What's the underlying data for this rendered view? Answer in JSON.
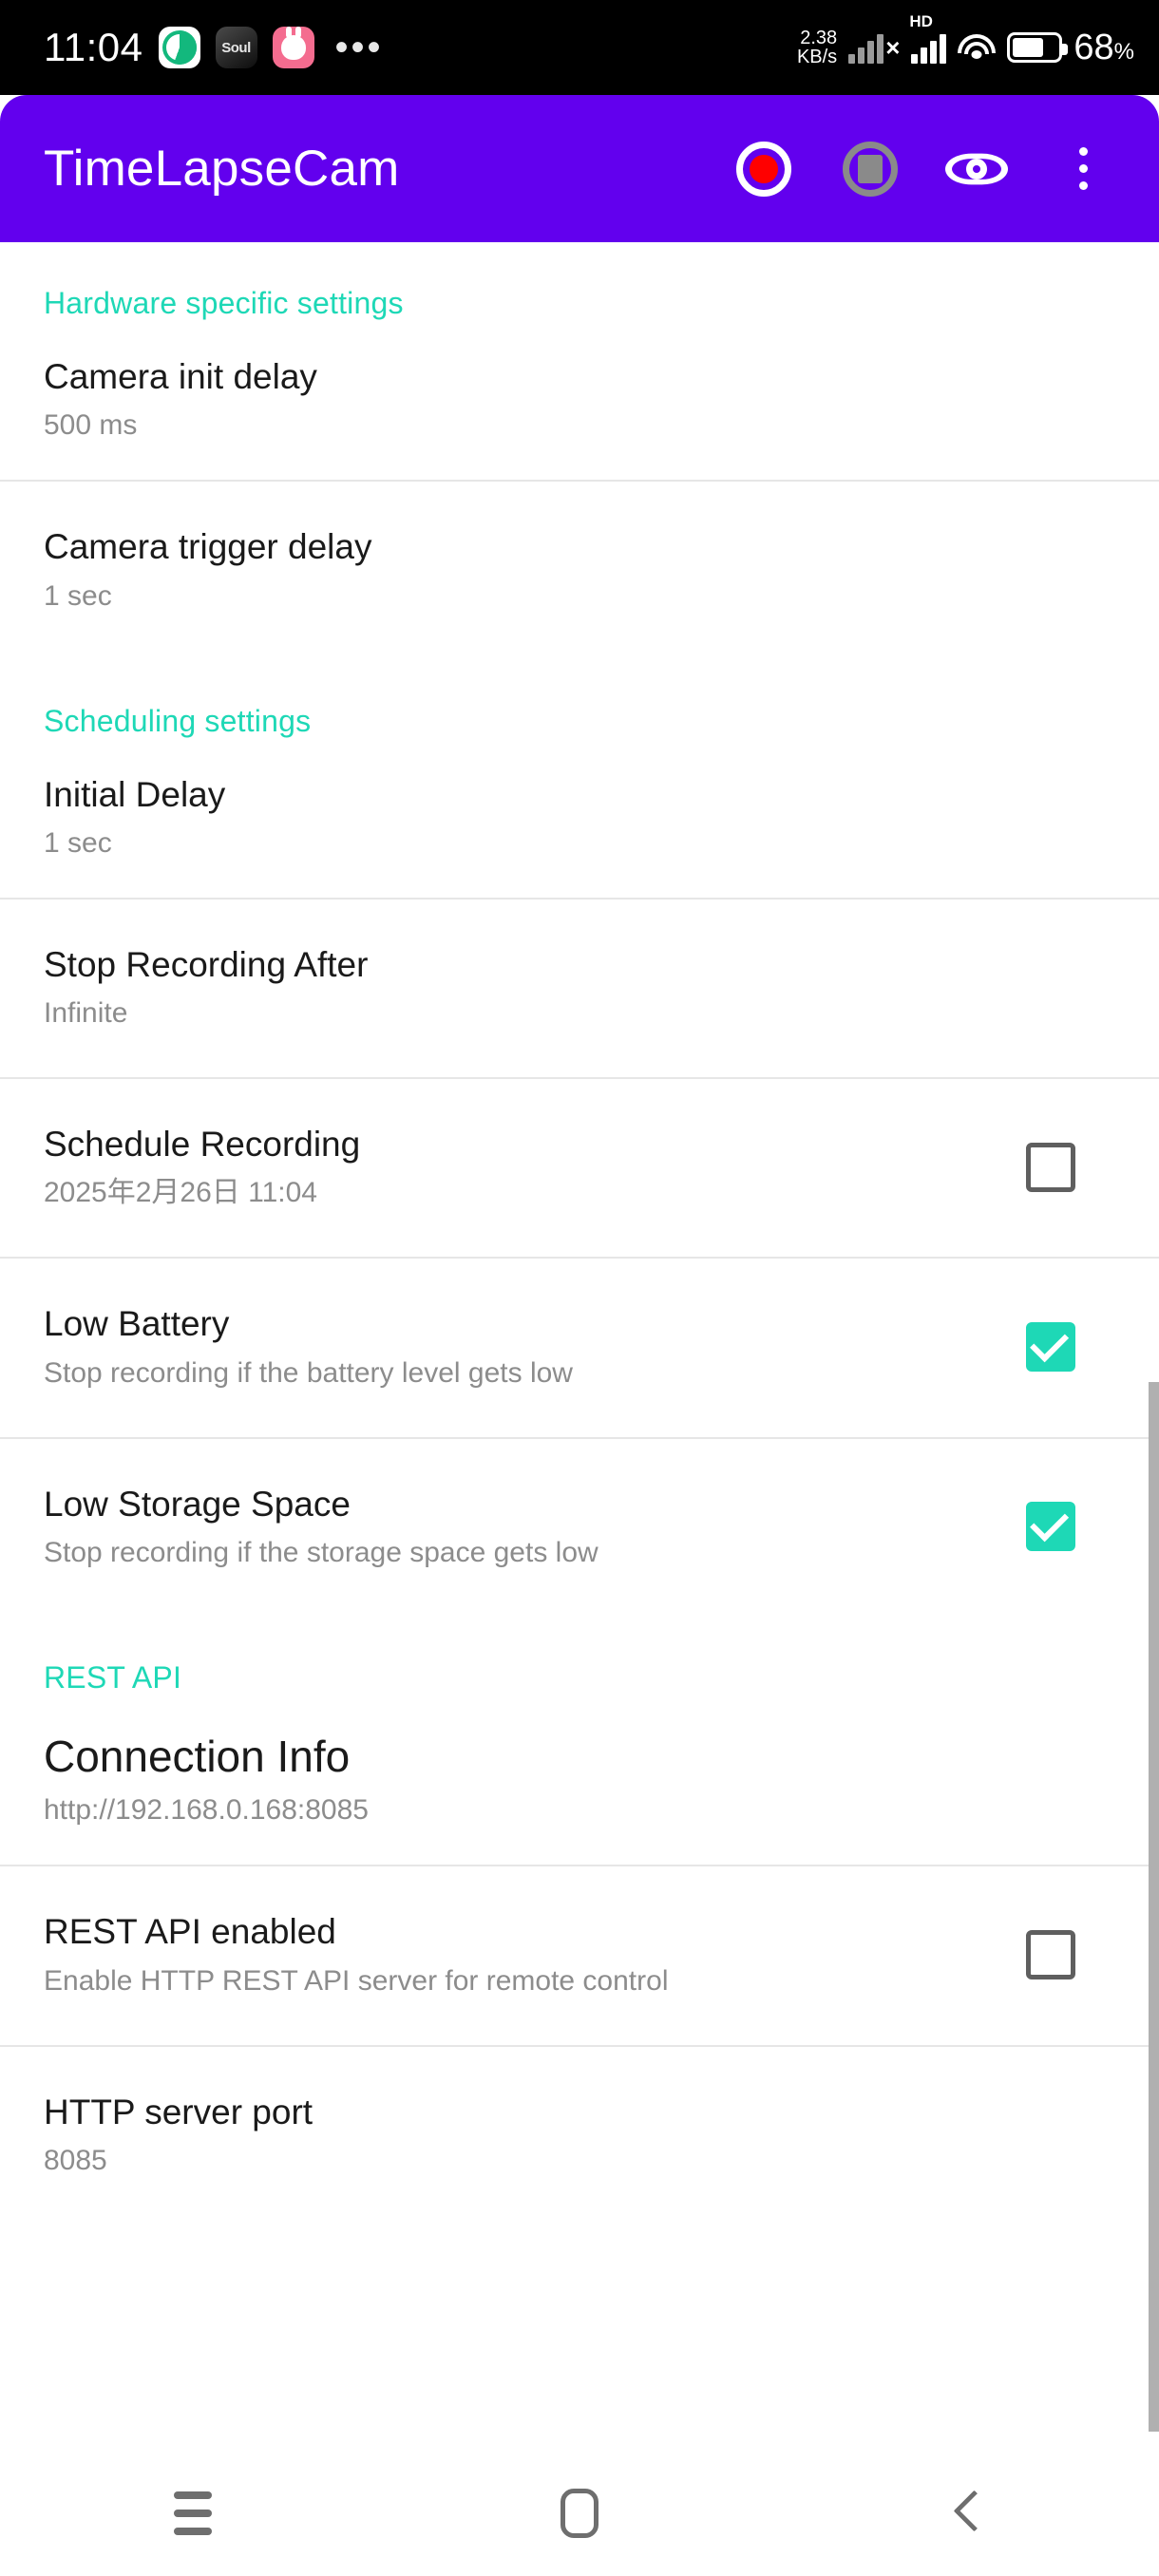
{
  "statusbar": {
    "clock": "11:04",
    "overflow_dots": "•••",
    "net_speed_value": "2.38",
    "net_speed_unit": "KB/s",
    "hd_label": "HD",
    "battery_percent": "68",
    "battery_percent_symbol": "%",
    "app_icons": [
      "green-swirl-app-icon",
      "soul-app-icon",
      "pink-bunny-app-icon"
    ],
    "soul_label": "Soul"
  },
  "appbar": {
    "title": "TimeLapseCam",
    "accent_color": "#6200ee",
    "actions": [
      {
        "name": "record-button",
        "label": "Record"
      },
      {
        "name": "stop-button",
        "label": "Stop"
      },
      {
        "name": "preview-button",
        "label": "Preview"
      },
      {
        "name": "overflow-menu-button",
        "label": "More options"
      }
    ]
  },
  "theme": {
    "section_header_color": "#1ed8b6",
    "checkbox_checked_color": "#1ed8b6",
    "record_dot_color": "#ff0000",
    "stop_disabled_color": "#8a8a8a"
  },
  "sections": [
    {
      "header": "Hardware specific settings",
      "rows": [
        {
          "title": "Camera init delay",
          "sub": "500 ms",
          "control": "none"
        },
        {
          "title": "Camera trigger delay",
          "sub": "1 sec",
          "control": "none"
        }
      ]
    },
    {
      "header": "Scheduling settings",
      "rows": [
        {
          "title": "Initial Delay",
          "sub": "1 sec",
          "control": "none"
        },
        {
          "title": "Stop Recording After",
          "sub": "Infinite",
          "control": "none"
        },
        {
          "title": "Schedule Recording",
          "sub": "2025年2月26日 11:04",
          "control": "checkbox",
          "checked": false
        },
        {
          "title": "Low Battery",
          "sub": "Stop recording if the battery level gets low",
          "control": "checkbox",
          "checked": true
        },
        {
          "title": "Low Storage Space",
          "sub": "Stop recording if the storage space gets low",
          "control": "checkbox",
          "checked": true
        }
      ]
    },
    {
      "header": "REST API",
      "rows": [
        {
          "title": "Connection Info",
          "sub": "http://192.168.0.168:8085",
          "control": "none",
          "big": true
        },
        {
          "title": "REST API enabled",
          "sub": "Enable HTTP REST API server for remote control",
          "control": "checkbox",
          "checked": false
        },
        {
          "title": "HTTP server port",
          "sub": "8085",
          "control": "none"
        }
      ]
    }
  ],
  "navbar": {
    "recents_label": "Recents",
    "home_label": "Home",
    "back_label": "Back"
  },
  "labels": {
    "hardware_header": "Hardware specific settings",
    "scheduling_header": "Scheduling settings",
    "rest_header": "REST API",
    "camera_init_delay_title": "Camera init delay",
    "camera_init_delay_value": "500 ms",
    "camera_trigger_delay_title": "Camera trigger delay",
    "camera_trigger_delay_value": "1 sec",
    "initial_delay_title": "Initial Delay",
    "initial_delay_value": "1 sec",
    "stop_after_title": "Stop Recording After",
    "stop_after_value": "Infinite",
    "schedule_rec_title": "Schedule Recording",
    "schedule_rec_value": "2025年2月26日 11:04",
    "low_battery_title": "Low Battery",
    "low_battery_value": "Stop recording if the battery level gets low",
    "low_storage_title": "Low Storage Space",
    "low_storage_value": "Stop recording if the storage space gets low",
    "connection_info_title": "Connection Info",
    "connection_info_value": "http://192.168.0.168:8085",
    "rest_enabled_title": "REST API enabled",
    "rest_enabled_value": "Enable HTTP REST API server for remote control",
    "http_port_title": "HTTP server port",
    "http_port_value": "8085"
  }
}
